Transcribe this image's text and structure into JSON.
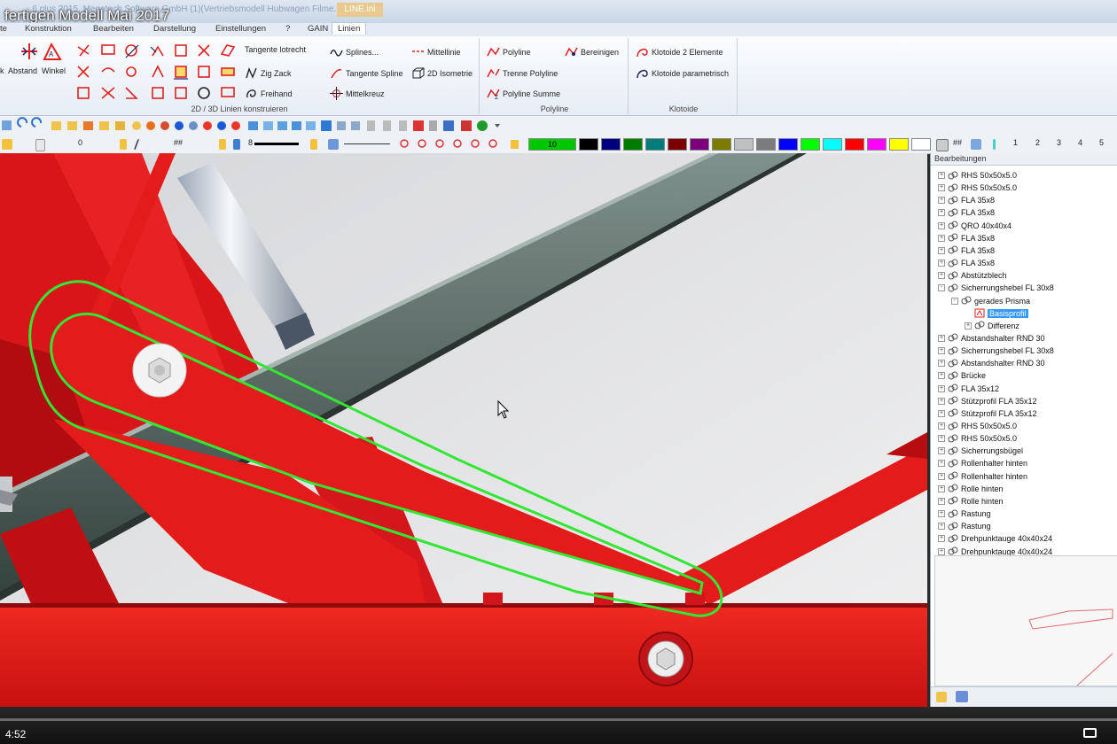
{
  "window": {
    "app_title": "...6.plus 2015, Megatech Software GmbH (1)(Vertriebsmodell Hubwagen Filme.PRT)",
    "file_tab": "LINE.ini",
    "video_title": "fertigen Modell Mai 2017"
  },
  "menu": {
    "items": [
      "te",
      "Konstruktion",
      "Bearbeiten",
      "Darstellung",
      "Einstellungen",
      "?",
      "GAIN",
      "Linien"
    ],
    "active": "Linien"
  },
  "ribbon": {
    "group_2d3d": {
      "title": "2D / 3D Linien konstruieren",
      "abstand": "Abstand",
      "winkel": "Winkel",
      "k": "k",
      "tangente_lotrecht": "Tangente lotrecht",
      "zig_zack": "Zig Zack",
      "freihand": "Freihand",
      "splines": "Splines...",
      "tangente_spline": "Tangente Spline",
      "mittelkreuz": "Mittelkreuz",
      "mittellinie": "Mittellinie",
      "isometrie": "2D Isometrie"
    },
    "group_polyline": {
      "title": "Polyline",
      "polyline": "Polyline",
      "bereinigen": "Bereinigen",
      "trenne_polyline": "Trenne Polyline",
      "polyline_summe": "Polyline Summe"
    },
    "group_klotoide": {
      "title": "Klotoide",
      "klotoide_2": "Klotoide 2 Elemente",
      "klotoide_param": "Klotoide parametrisch"
    }
  },
  "toolbar2": {
    "layer_value": "0",
    "hash_label": "##",
    "line_width": "8",
    "color_value": "10",
    "hash_label_right": "##",
    "view_numbers": [
      "1",
      "2",
      "3",
      "4",
      "5"
    ],
    "palette": [
      "#00c800",
      "#000000",
      "#00007c",
      "#007c00",
      "#007c7c",
      "#7c0000",
      "#7c007c",
      "#7c7c00",
      "#c0c0c0",
      "#7c7c7c",
      "#0000ff",
      "#00ff00",
      "#00ffff",
      "#ff0000",
      "#ff00ff",
      "#ffff00",
      "#ffffff"
    ]
  },
  "panel": {
    "title": "Bearbeitungen",
    "tree": [
      {
        "label": "RHS 50x50x5.0",
        "level": 0,
        "expander": "+"
      },
      {
        "label": "RHS 50x50x5.0",
        "level": 0,
        "expander": "+"
      },
      {
        "label": "FLA 35x8",
        "level": 0,
        "expander": "+"
      },
      {
        "label": "FLA 35x8",
        "level": 0,
        "expander": "+"
      },
      {
        "label": "QRO 40x40x4",
        "level": 0,
        "expander": "+"
      },
      {
        "label": "FLA 35x8",
        "level": 0,
        "expander": "+"
      },
      {
        "label": "FLA 35x8",
        "level": 0,
        "expander": "+"
      },
      {
        "label": "FLA 35x8",
        "level": 0,
        "expander": "+"
      },
      {
        "label": "Abstützblech",
        "level": 0,
        "expander": "+"
      },
      {
        "label": "Sicherrungshebel FL 30x8",
        "level": 0,
        "expander": "-"
      },
      {
        "label": "gerades Prisma",
        "level": 1,
        "expander": "-"
      },
      {
        "label": "Basisprofil",
        "level": 2,
        "expander": "",
        "selected": true
      },
      {
        "label": "Differenz",
        "level": 2,
        "expander": "+"
      },
      {
        "label": "Abstandshalter RND 30",
        "level": 0,
        "expander": "+"
      },
      {
        "label": "Sicherrungshebel FL 30x8",
        "level": 0,
        "expander": "+"
      },
      {
        "label": "Abstandshalter RND 30",
        "level": 0,
        "expander": "+"
      },
      {
        "label": "Brücke",
        "level": 0,
        "expander": "+"
      },
      {
        "label": "FLA 35x12",
        "level": 0,
        "expander": "+"
      },
      {
        "label": "Stützprofil FLA 35x12",
        "level": 0,
        "expander": "+"
      },
      {
        "label": "Stützprofil FLA 35x12",
        "level": 0,
        "expander": "+"
      },
      {
        "label": "RHS 50x50x5.0",
        "level": 0,
        "expander": "+"
      },
      {
        "label": "RHS 50x50x5.0",
        "level": 0,
        "expander": "+"
      },
      {
        "label": "Sicherrungsbügel",
        "level": 0,
        "expander": "+"
      },
      {
        "label": "Rollenhalter hinten",
        "level": 0,
        "expander": "+"
      },
      {
        "label": "Rollenhalter hinten",
        "level": 0,
        "expander": "+"
      },
      {
        "label": "Rolle hinten",
        "level": 0,
        "expander": "+"
      },
      {
        "label": "Rolle hinten",
        "level": 0,
        "expander": "+"
      },
      {
        "label": "Rastung",
        "level": 0,
        "expander": "+"
      },
      {
        "label": "Rastung",
        "level": 0,
        "expander": "+"
      },
      {
        "label": "Drehpunktauge 40x40x24",
        "level": 0,
        "expander": "+"
      },
      {
        "label": "Drehpunktauge 40x40x24",
        "level": 0,
        "expander": "+"
      }
    ]
  },
  "video": {
    "time": "4:52"
  },
  "colors": {
    "part_red": "#e41b1b",
    "selection_green": "#33e633",
    "steel": "#5a6b66"
  }
}
